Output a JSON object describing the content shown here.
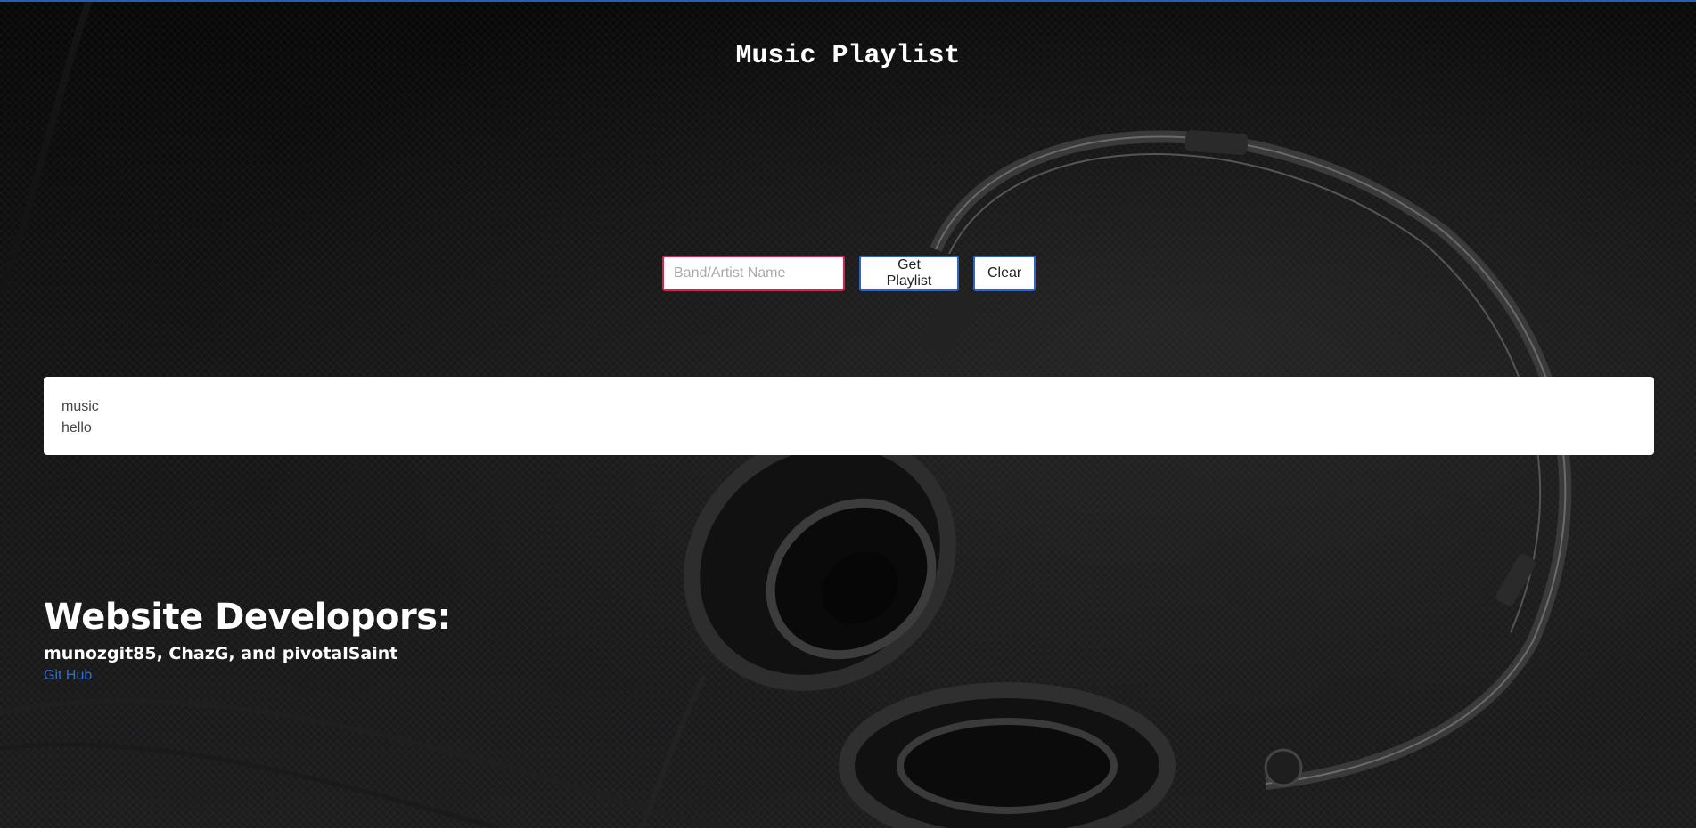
{
  "header": {
    "title": "Music Playlist"
  },
  "search": {
    "placeholder": "Band/Artist Name",
    "value": "",
    "get_playlist_label": "Get Playlist",
    "clear_label": "Clear"
  },
  "results": {
    "lines": [
      "music",
      "hello"
    ]
  },
  "developers": {
    "heading": "Website Developors:",
    "names": "munozgit85, ChazG, and pivotalSaint",
    "link_label": "Git Hub"
  },
  "colors": {
    "accent": "#2f64c8",
    "input_border": "#d2264e",
    "link": "#2f6cd8",
    "background": "#141415"
  },
  "background_image": "headphones-photo"
}
